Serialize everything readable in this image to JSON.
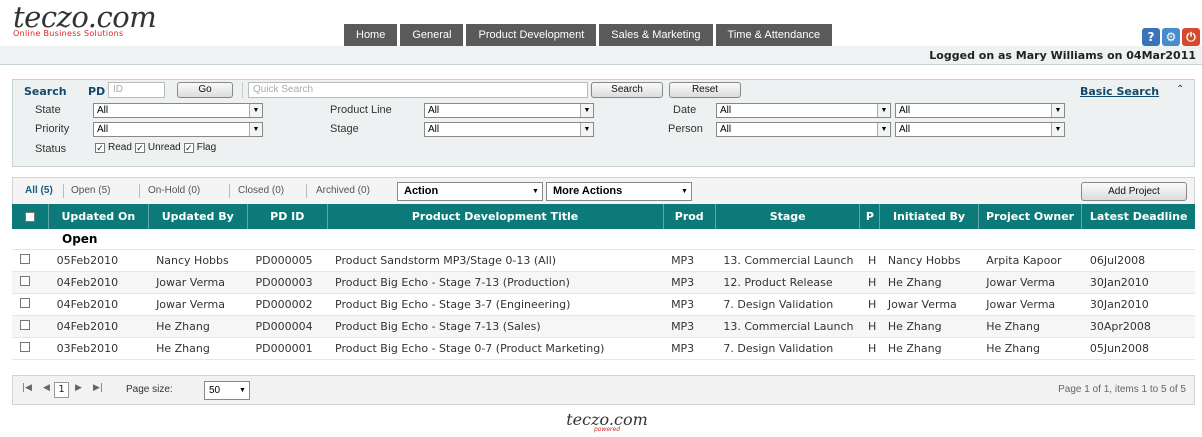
{
  "logo": {
    "main": "teczo.com",
    "tagline": "Online Business Solutions"
  },
  "nav": [
    "Home",
    "General",
    "Product Development",
    "Sales & Marketing",
    "Time & Attendance"
  ],
  "top_icons": [
    {
      "name": "help-icon",
      "glyph": "?"
    },
    {
      "name": "settings-icon",
      "glyph": "⚙"
    },
    {
      "name": "power-icon",
      "glyph": "⏻"
    }
  ],
  "logged_in": "Logged on as Mary Williams on 04Mar2011",
  "search": {
    "label": "Search",
    "pd_label": "PD",
    "pd_placeholder": "ID",
    "go": "Go",
    "quick_placeholder": "Quick Search",
    "search_btn": "Search",
    "reset_btn": "Reset",
    "basic_search": "Basic Search",
    "filters": {
      "state_label": "State",
      "state_value": "All",
      "priority_label": "Priority",
      "priority_value": "All",
      "status_label": "Status",
      "product_line_label": "Product Line",
      "product_line_value": "All",
      "stage_label": "Stage",
      "stage_value": "All",
      "date_label": "Date",
      "date_value": "All",
      "date_value2": "All",
      "person_label": "Person",
      "person_value": "All",
      "person_value2": "All"
    },
    "status_checks": [
      "Read",
      "Unread",
      "Flag"
    ]
  },
  "views": {
    "all": "All (5)",
    "open": "Open (5)",
    "onhold": "On-Hold (0)",
    "closed": "Closed (0)",
    "archived": "Archived (0)",
    "action": "Action",
    "more_actions": "More Actions",
    "add_project": "Add Project"
  },
  "table": {
    "columns": [
      "Updated On",
      "Updated By",
      "PD ID",
      "Product Development Title",
      "Prod",
      "Stage",
      "P",
      "Initiated By",
      "Project Owner",
      "Latest Deadline"
    ],
    "group": "Open",
    "rows": [
      [
        "05Feb2010",
        "Nancy Hobbs",
        "PD000005",
        "Product Sandstorm MP3/Stage 0-13 (All)",
        "MP3",
        "13. Commercial Launch",
        "H",
        "Nancy Hobbs",
        "Arpita Kapoor",
        "06Jul2008"
      ],
      [
        "04Feb2010",
        "Jowar Verma",
        "PD000003",
        "Product Big Echo - Stage 7-13 (Production)",
        "MP3",
        "12. Product Release",
        "H",
        "He Zhang",
        "Jowar Verma",
        "30Jan2010"
      ],
      [
        "04Feb2010",
        "Jowar Verma",
        "PD000002",
        "Product Big Echo - Stage 3-7  (Engineering)",
        "MP3",
        "7. Design Validation",
        "H",
        "Jowar Verma",
        "Jowar Verma",
        "30Jan2010"
      ],
      [
        "04Feb2010",
        "He Zhang",
        "PD000004",
        "Product Big Echo - Stage 7-13 (Sales)",
        "MP3",
        "13. Commercial Launch",
        "H",
        "He Zhang",
        "He Zhang",
        "30Apr2008"
      ],
      [
        "03Feb2010",
        "He Zhang",
        "PD000001",
        "Product Big Echo - Stage 0-7 (Product Marketing)",
        "MP3",
        "7. Design Validation",
        "H",
        "He Zhang",
        "He Zhang",
        "05Jun2008"
      ]
    ]
  },
  "pager": {
    "current": "1",
    "page_size_label": "Page size:",
    "page_size": "50",
    "summary": "Page 1 of 1, items 1 to 5 of 5"
  },
  "footer": {
    "logo": "teczo.com",
    "sub": "powered"
  }
}
